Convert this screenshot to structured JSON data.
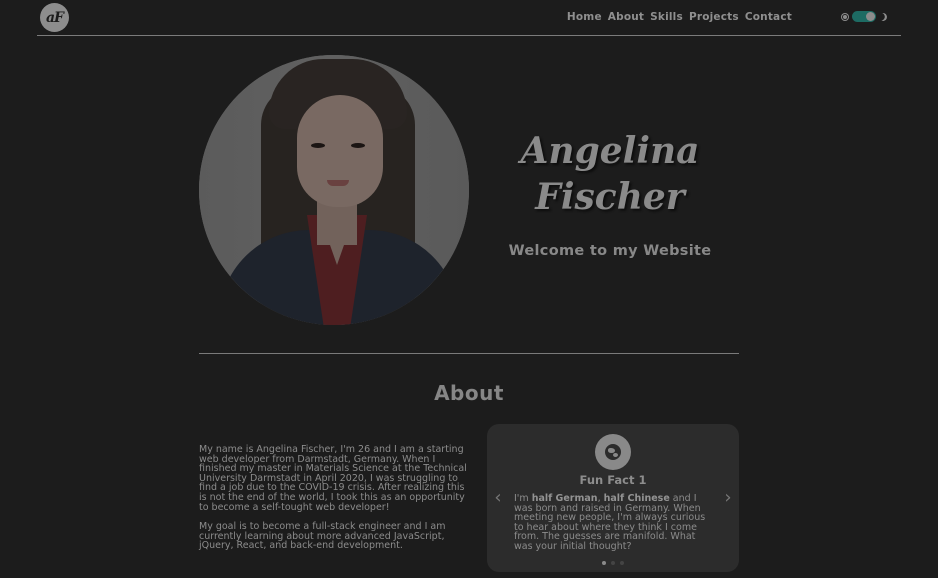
{
  "header": {
    "logo_text": "aF",
    "nav": [
      "Home",
      "About",
      "Skills",
      "Projects",
      "Contact"
    ],
    "theme_toggle": {
      "light_icon": "sun-icon",
      "dark_icon": "moon-icon",
      "state": "dark",
      "accent": "#1d6b63"
    }
  },
  "hero": {
    "first_name": "Angelina",
    "last_name": "Fischer",
    "welcome": "Welcome to my Website"
  },
  "about": {
    "title": "About",
    "paragraph1": "My name is Angelina Fischer, I'm 26 and I am a starting web developer from Darmstadt, Germany. When I finished my master in Materials Science at the Technical University Darmstadt in April 2020, I was struggling to find a job due to the COVID-19 crisis. After realizing this is not the end of the world, I took this as an opportunity to become a self-tought web developer!",
    "paragraph2": "My goal is to become a full-stack engineer and I am currently learning about more advanced JavaScript, jQuery, React, and back-end development."
  },
  "fun_fact": {
    "icon": "globe-icon",
    "title": "Fun Fact 1",
    "text_intro": "I'm ",
    "bold1": "half German",
    "sep": ", ",
    "bold2": "half Chinese",
    "text_rest": " and I was born and raised in Germany. When meeting new people, I'm always curious to hear about where they think I come from. The guesses are manifold. What was your initial thought?",
    "prev": "‹",
    "next": "›",
    "slide_count": 3,
    "active_slide": 1
  },
  "colors": {
    "background": "#1c1c1c",
    "card": "#2c2c2c",
    "text": "#8c8c8c"
  }
}
